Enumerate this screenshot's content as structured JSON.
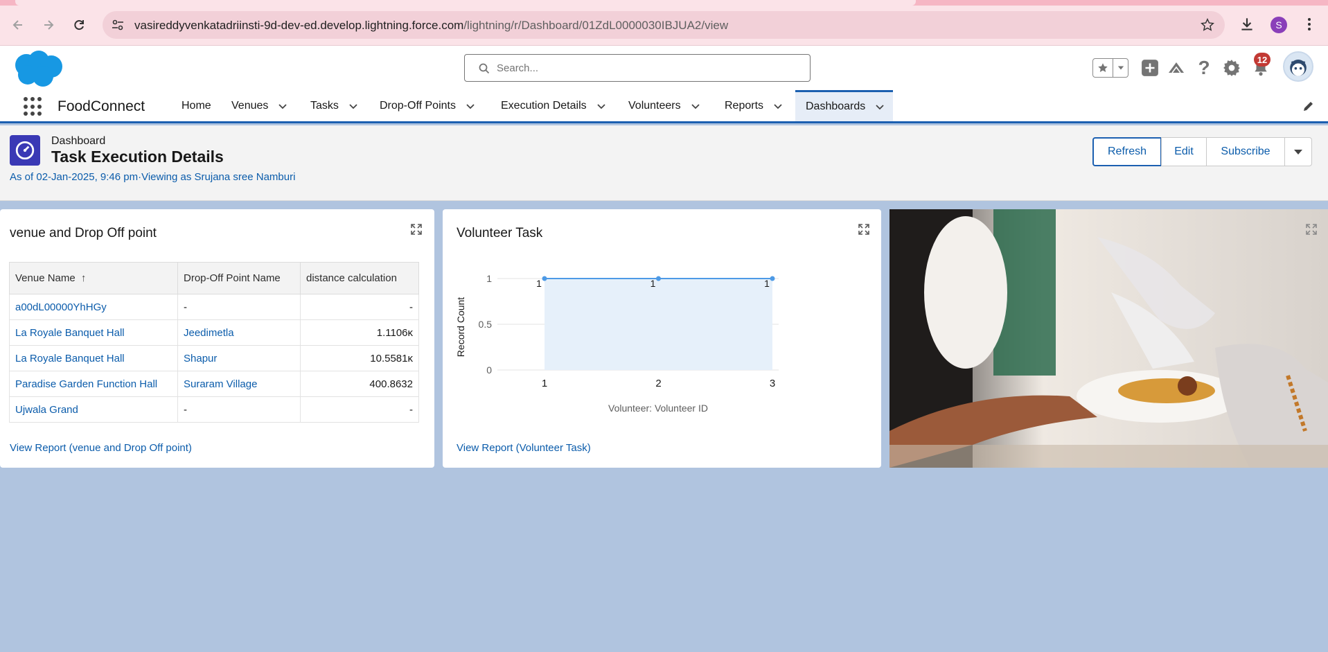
{
  "browser": {
    "url_host": "vasireddyvenkatadriinsti-9d-dev-ed.develop.lightning.force.com",
    "url_path": "/lightning/r/Dashboard/01ZdL0000030IBJUA2/view",
    "profile_initial": "S"
  },
  "header": {
    "search_placeholder": "Search...",
    "notification_count": "12"
  },
  "nav": {
    "app_name": "FoodConnect",
    "items": [
      {
        "label": "Home"
      },
      {
        "label": "Venues"
      },
      {
        "label": "Tasks"
      },
      {
        "label": "Drop-Off Points"
      },
      {
        "label": "Execution Details"
      },
      {
        "label": "Volunteers"
      },
      {
        "label": "Reports"
      },
      {
        "label": "Dashboards"
      }
    ]
  },
  "page": {
    "object_label": "Dashboard",
    "title": "Task Execution Details",
    "as_of": "As of 02-Jan-2025, 9:46 pm·Viewing as Srujana sree Namburi",
    "buttons": {
      "refresh": "Refresh",
      "edit": "Edit",
      "subscribe": "Subscribe"
    }
  },
  "widgets": {
    "table": {
      "title": "venue and Drop Off point",
      "columns": [
        "Venue Name",
        "Drop-Off Point Name",
        "distance calculation"
      ],
      "sort_indicator": "↑",
      "rows": [
        {
          "venue": "a00dL00000YhHGy",
          "dropoff": "-",
          "distance": "-"
        },
        {
          "venue": "La Royale Banquet Hall",
          "dropoff": "Jeedimetla",
          "distance": "1.1106ĸ"
        },
        {
          "venue": "La Royale Banquet Hall",
          "dropoff": "Shapur",
          "distance": "10.5581ĸ"
        },
        {
          "venue": "Paradise Garden Function Hall",
          "dropoff": "Suraram Village",
          "distance": "400.8632"
        },
        {
          "venue": "Ujwala Grand",
          "dropoff": "-",
          "distance": "-"
        }
      ],
      "link": "View Report (venue and Drop Off point)"
    },
    "chart": {
      "title": "Volunteer Task",
      "link": "View Report (Volunteer Task)"
    }
  },
  "chart_data": {
    "type": "area",
    "title": "Volunteer Task",
    "xlabel": "Volunteer: Volunteer ID",
    "ylabel": "Record Count",
    "x": [
      "1",
      "2",
      "3"
    ],
    "values": [
      1,
      1,
      1
    ],
    "data_labels": [
      "1",
      "1",
      "1"
    ],
    "yticks": [
      "0",
      "0.5",
      "1"
    ],
    "ylim": [
      0,
      1
    ],
    "grid": true,
    "colors": {
      "line": "#4d9ae6",
      "fill": "#e6f0fa"
    }
  }
}
